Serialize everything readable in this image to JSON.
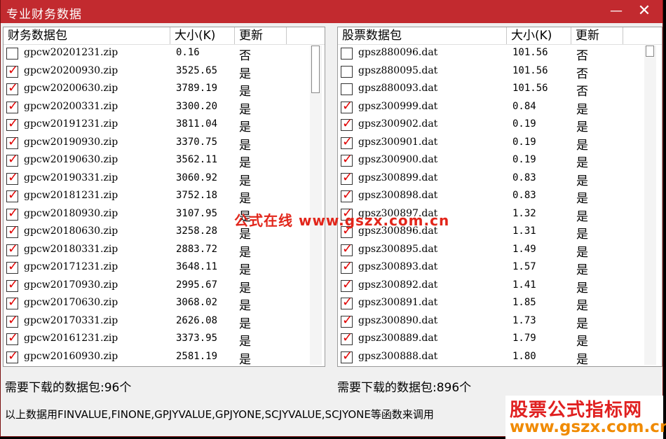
{
  "window": {
    "title": "专业财务数据",
    "minimize_glyph": "—",
    "close_glyph": "✕"
  },
  "left_panel": {
    "columns": [
      "财务数据包",
      "大小(K)",
      "更新"
    ],
    "rows": [
      {
        "name": "gpcw20201231.zip",
        "size": "0.16",
        "update": "否",
        "checked": false
      },
      {
        "name": "gpcw20200930.zip",
        "size": "3525.65",
        "update": "是",
        "checked": true
      },
      {
        "name": "gpcw20200630.zip",
        "size": "3789.19",
        "update": "是",
        "checked": true
      },
      {
        "name": "gpcw20200331.zip",
        "size": "3300.20",
        "update": "是",
        "checked": true
      },
      {
        "name": "gpcw20191231.zip",
        "size": "3811.04",
        "update": "是",
        "checked": true
      },
      {
        "name": "gpcw20190930.zip",
        "size": "3370.75",
        "update": "是",
        "checked": true
      },
      {
        "name": "gpcw20190630.zip",
        "size": "3562.11",
        "update": "是",
        "checked": true
      },
      {
        "name": "gpcw20190331.zip",
        "size": "3060.92",
        "update": "是",
        "checked": true
      },
      {
        "name": "gpcw20181231.zip",
        "size": "3752.18",
        "update": "是",
        "checked": true
      },
      {
        "name": "gpcw20180930.zip",
        "size": "3107.95",
        "update": "是",
        "checked": true
      },
      {
        "name": "gpcw20180630.zip",
        "size": "3258.28",
        "update": "是",
        "checked": true
      },
      {
        "name": "gpcw20180331.zip",
        "size": "2883.72",
        "update": "是",
        "checked": true
      },
      {
        "name": "gpcw20171231.zip",
        "size": "3648.11",
        "update": "是",
        "checked": true
      },
      {
        "name": "gpcw20170930.zip",
        "size": "2995.67",
        "update": "是",
        "checked": true
      },
      {
        "name": "gpcw20170630.zip",
        "size": "3068.02",
        "update": "是",
        "checked": true
      },
      {
        "name": "gpcw20170331.zip",
        "size": "2626.08",
        "update": "是",
        "checked": true
      },
      {
        "name": "gpcw20161231.zip",
        "size": "3373.95",
        "update": "是",
        "checked": true
      },
      {
        "name": "gpcw20160930.zip",
        "size": "2581.19",
        "update": "是",
        "checked": true
      }
    ],
    "scroll_fraction": 0.0
  },
  "right_panel": {
    "columns": [
      "股票数据包",
      "大小(K)",
      "更新"
    ],
    "rows": [
      {
        "name": "gpsz880096.dat",
        "size": "101.56",
        "update": "否",
        "checked": false
      },
      {
        "name": "gpsz880095.dat",
        "size": "101.56",
        "update": "否",
        "checked": false
      },
      {
        "name": "gpsz880093.dat",
        "size": "101.56",
        "update": "否",
        "checked": false
      },
      {
        "name": "gpsz300999.dat",
        "size": "0.84",
        "update": "是",
        "checked": true
      },
      {
        "name": "gpsz300902.dat",
        "size": "0.19",
        "update": "是",
        "checked": true
      },
      {
        "name": "gpsz300901.dat",
        "size": "0.19",
        "update": "是",
        "checked": true
      },
      {
        "name": "gpsz300900.dat",
        "size": "0.19",
        "update": "是",
        "checked": true
      },
      {
        "name": "gpsz300899.dat",
        "size": "0.83",
        "update": "是",
        "checked": true
      },
      {
        "name": "gpsz300898.dat",
        "size": "0.83",
        "update": "是",
        "checked": true
      },
      {
        "name": "gpsz300897.dat",
        "size": "1.32",
        "update": "是",
        "checked": true
      },
      {
        "name": "gpsz300896.dat",
        "size": "1.31",
        "update": "是",
        "checked": true
      },
      {
        "name": "gpsz300895.dat",
        "size": "1.49",
        "update": "是",
        "checked": true
      },
      {
        "name": "gpsz300893.dat",
        "size": "1.57",
        "update": "是",
        "checked": true
      },
      {
        "name": "gpsz300892.dat",
        "size": "1.41",
        "update": "是",
        "checked": true
      },
      {
        "name": "gpsz300891.dat",
        "size": "1.85",
        "update": "是",
        "checked": true
      },
      {
        "name": "gpsz300890.dat",
        "size": "1.73",
        "update": "是",
        "checked": true
      },
      {
        "name": "gpsz300889.dat",
        "size": "1.79",
        "update": "是",
        "checked": true
      },
      {
        "name": "gpsz300888.dat",
        "size": "1.80",
        "update": "是",
        "checked": true
      }
    ],
    "scroll_fraction": 0.0
  },
  "status": {
    "left_count": "需要下载的数据包:96个",
    "right_count": "需要下载的数据包:896个",
    "note": "以上数据用FINVALUE,FINONE,GPJYVALUE,GPJYONE,SCJYVALUE,SCJYONE等函数来调用"
  },
  "watermarks": {
    "center": "公式在线 www.gszx.com.cn",
    "corner_line1": "股票公式指标网",
    "corner_line2": "www.gszx.com.cn"
  },
  "colors": {
    "titlebar": "#c22a2f",
    "check_mark": "#e00000",
    "watermark_red": "#e2261b",
    "watermark_orange": "#f08a00"
  },
  "icons": {
    "check": "check-mark-icon"
  }
}
